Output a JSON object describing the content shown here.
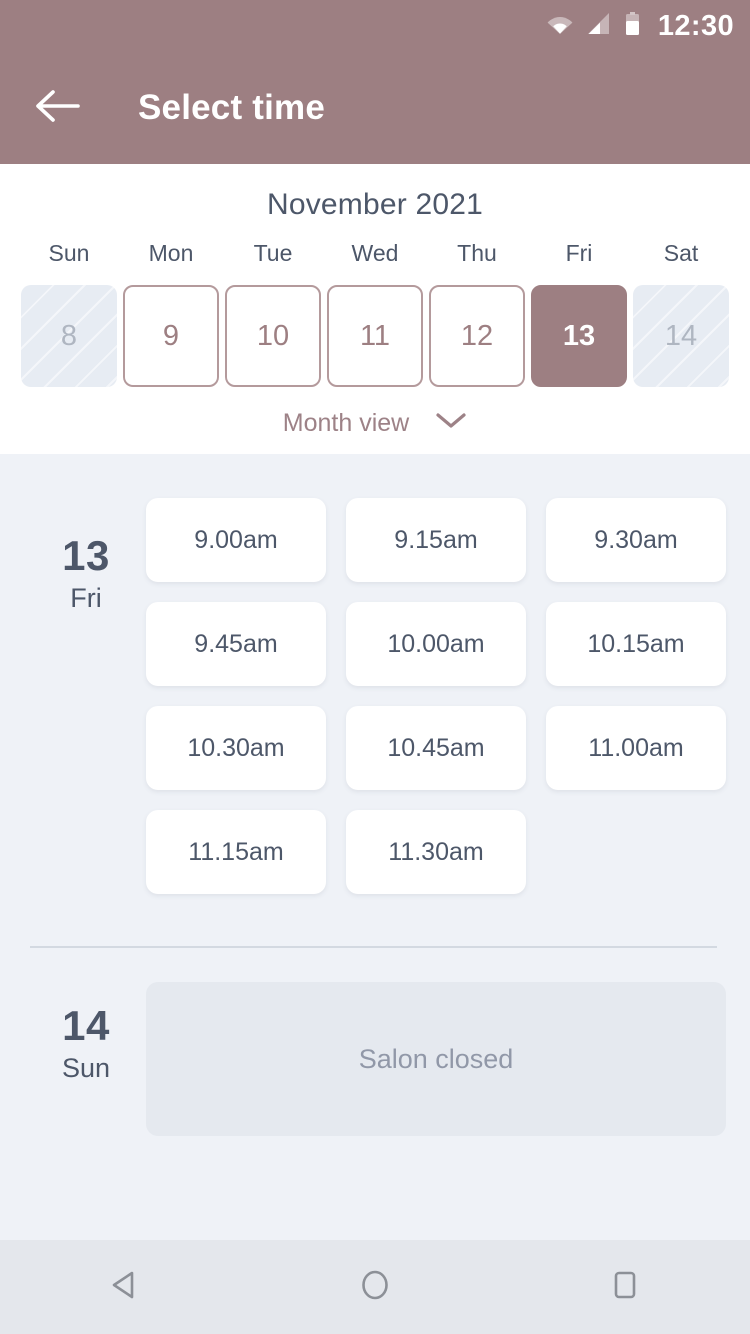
{
  "status_bar": {
    "time": "12:30",
    "icons": [
      "wifi-icon",
      "cellular-signal-icon",
      "battery-icon"
    ]
  },
  "app_bar": {
    "title": "Select time",
    "back_icon": "arrow-left-icon"
  },
  "calendar": {
    "month_title": "November 2021",
    "weekdays": [
      "Sun",
      "Mon",
      "Tue",
      "Wed",
      "Thu",
      "Fri",
      "Sat"
    ],
    "days": [
      {
        "number": "8",
        "state": "disabled"
      },
      {
        "number": "9",
        "state": "enabled"
      },
      {
        "number": "10",
        "state": "enabled"
      },
      {
        "number": "11",
        "state": "enabled"
      },
      {
        "number": "12",
        "state": "enabled"
      },
      {
        "number": "13",
        "state": "selected"
      },
      {
        "number": "14",
        "state": "disabled"
      }
    ],
    "view_toggle": {
      "label": "Month view",
      "chevron_icon": "chevron-down-icon"
    }
  },
  "schedule": {
    "days": [
      {
        "day_number": "13",
        "day_of_week": "Fri",
        "slots": [
          "9.00am",
          "9.15am",
          "9.30am",
          "9.45am",
          "10.00am",
          "10.15am",
          "10.30am",
          "10.45am",
          "11.00am",
          "11.15am",
          "11.30am"
        ],
        "closed_message": null
      },
      {
        "day_number": "14",
        "day_of_week": "Sun",
        "slots": [],
        "closed_message": "Salon closed"
      }
    ]
  },
  "nav_bar": {
    "buttons": [
      "back-triangle-icon",
      "home-circle-icon",
      "recents-square-icon"
    ]
  },
  "colors": {
    "brand": "#9D7F82",
    "text_dark": "#4D5769",
    "background": "#EFF2F7",
    "panel": "#FFFFFF",
    "disabled_cell": "#E7ECF3",
    "closed_box": "#E5E9EF"
  }
}
